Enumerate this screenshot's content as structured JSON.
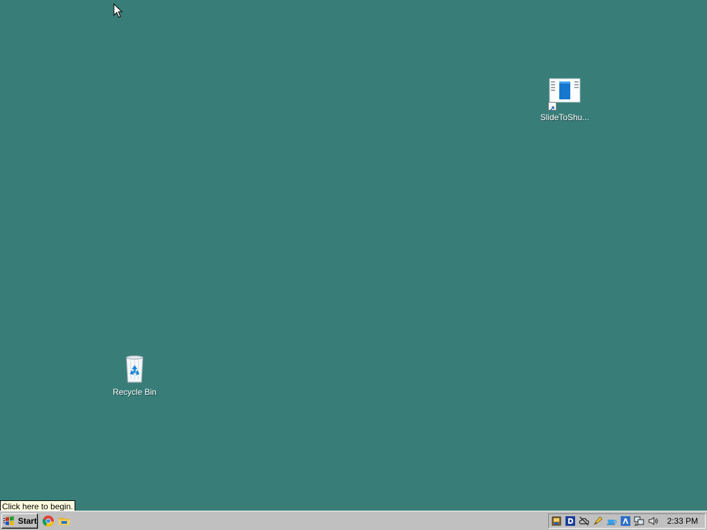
{
  "desktop": {
    "background": "#387d78",
    "icons": [
      {
        "label": "Recycle Bin",
        "icon": "recycle-bin-icon"
      },
      {
        "label": "SlideToShu...",
        "icon": "shortcut-app-icon"
      }
    ]
  },
  "tooltip": {
    "text": "Click here to begin."
  },
  "taskbar": {
    "start_label": "Start",
    "quick_launch": [
      {
        "icon": "chrome-icon"
      },
      {
        "icon": "file-explorer-icon"
      }
    ],
    "tray_icons": [
      "tray-app-icon",
      "tray-d-icon",
      "tray-cloud-offline-icon",
      "tray-pen-icon",
      "tray-cup-icon",
      "tray-update-icon",
      "network-icon",
      "volume-icon"
    ],
    "clock": "2:33 PM"
  }
}
